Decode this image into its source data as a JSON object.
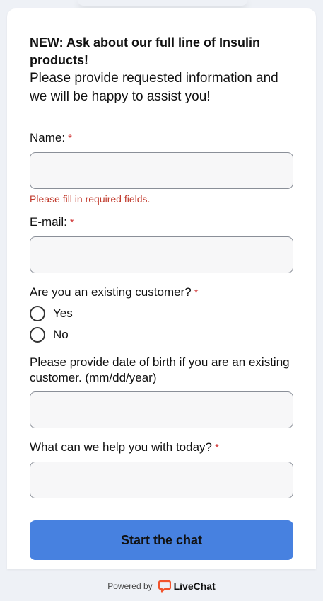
{
  "intro": {
    "headline": "NEW: Ask about our full line of Insulin products!",
    "message": "Please provide requested information and we will be happy to assist you!"
  },
  "form": {
    "name": {
      "label": "Name:",
      "required_mark": "*",
      "value": ""
    },
    "error": "Please fill in required fields.",
    "email": {
      "label": "E-mail:",
      "required_mark": "*",
      "value": ""
    },
    "existing_customer": {
      "label": "Are you an existing customer?",
      "required_mark": "*",
      "options": [
        "Yes",
        "No"
      ]
    },
    "dob": {
      "label": "Please provide date of birth if you are an existing customer. (mm/dd/year)",
      "value": ""
    },
    "help": {
      "label": "What can we help you with today?",
      "required_mark": "*",
      "value": ""
    },
    "submit_label": "Start the chat"
  },
  "footer": {
    "powered_by": "Powered by",
    "brand": "LiveChat",
    "brand_color": "#f2542d"
  },
  "colors": {
    "accent": "#4781e0",
    "error": "#c0392b",
    "required": "#d23c3c"
  }
}
